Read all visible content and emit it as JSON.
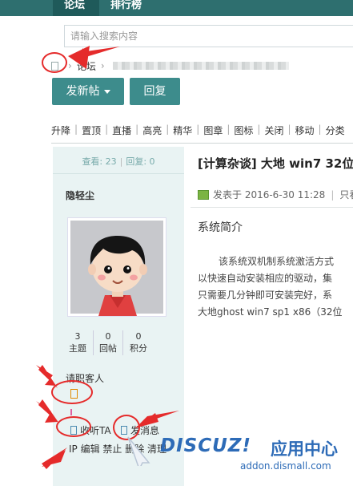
{
  "nav": {
    "tabs": [
      {
        "label": "论坛"
      },
      {
        "label": "排行榜"
      }
    ]
  },
  "search": {
    "placeholder": "请输入搜索内容"
  },
  "breadcrumb": {
    "home_icon": "home-icon",
    "forum": "论坛",
    "separator": "›"
  },
  "actions": {
    "post_label": "发新帖",
    "reply_label": "回复"
  },
  "mod_toolbar": [
    "升降",
    "置顶",
    "直播",
    "高亮",
    "精华",
    "图章",
    "图标",
    "关闭",
    "移动",
    "分类"
  ],
  "thread_stats": {
    "views": "查看: 23",
    "replies": "回复: 0"
  },
  "author": {
    "name": "隐轻尘",
    "stats": [
      {
        "value": "3",
        "label": "主题"
      },
      {
        "value": "0",
        "label": "回帖"
      },
      {
        "value": "0",
        "label": "积分"
      }
    ],
    "level": "请职客人",
    "follow": "收听TA",
    "message": "发消息",
    "admin_links": "IP 编辑 禁止 删除 清理"
  },
  "post": {
    "title": "[计算杂谈] 大地 win7 32位",
    "posted_at": "发表于 2016-6-30 11:28",
    "view_only": "只看",
    "section_title": "系统简介",
    "body_lines": [
      "该系统双机制系统激活方式",
      "以快速自动安装相应的驱动，集",
      "只需要几分钟即可安装完好，系",
      "大地ghost win7 sp1 x86（32位"
    ]
  },
  "watermark": {
    "logo": "DISCUZ!",
    "text": "应用中心",
    "url": "addon.dismall.com"
  },
  "colors": {
    "nav": "#2e6f6f",
    "button": "#3d8c8c",
    "sidebar": "#e9f3f3",
    "annotation": "#e52b2b",
    "watermark": "#2d6bb7"
  }
}
